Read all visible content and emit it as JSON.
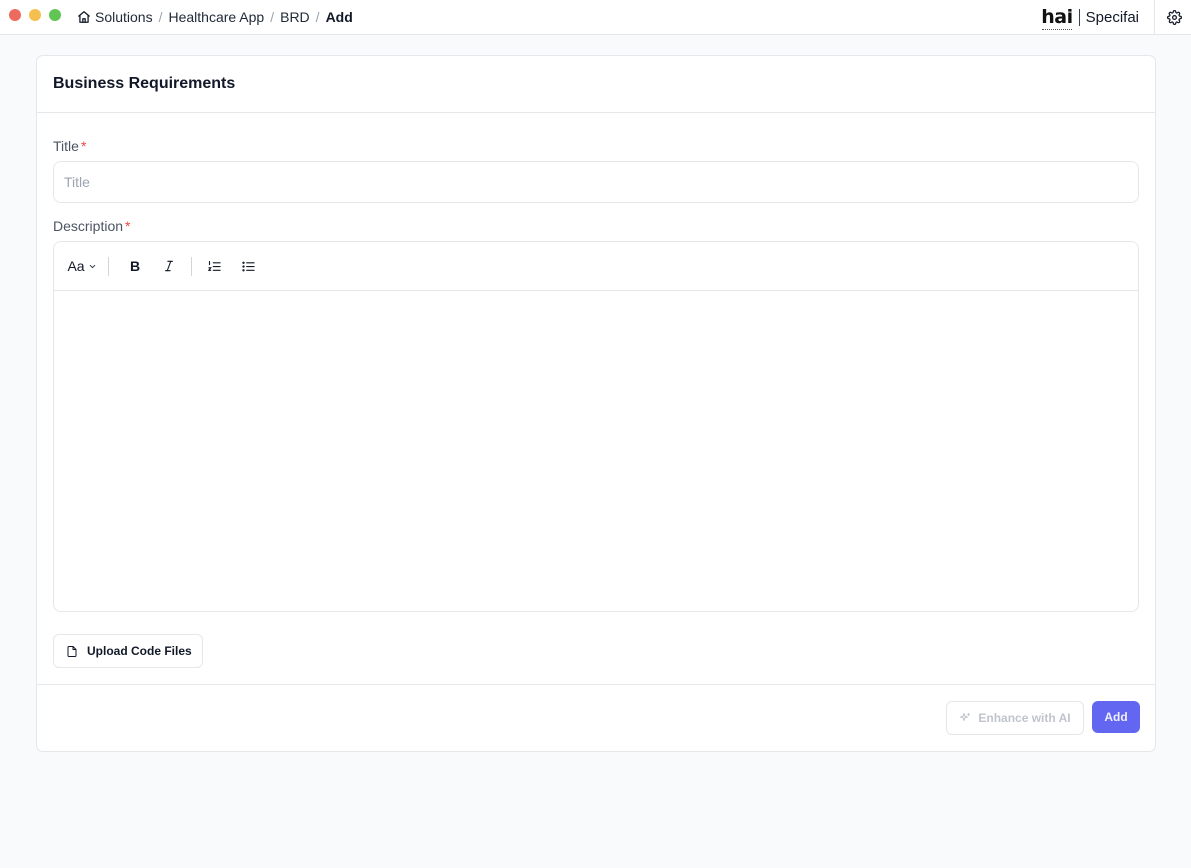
{
  "window": {
    "controls": [
      "close",
      "minimize",
      "maximize"
    ]
  },
  "breadcrumb": {
    "items": [
      "Solutions",
      "Healthcare App",
      "BRD"
    ],
    "current": "Add",
    "separator": "/"
  },
  "brand": {
    "logo_text": "hai",
    "product_name": "Specifai"
  },
  "card": {
    "title": "Business Requirements"
  },
  "form": {
    "title_label": "Title",
    "title_placeholder": "Title",
    "title_value": "",
    "description_label": "Description",
    "required_mark": "*",
    "description_value": ""
  },
  "editor_toolbar": {
    "font_size_label": "Aa",
    "bold_label": "B",
    "tools": [
      "font-size-dropdown",
      "bold",
      "italic",
      "ordered-list",
      "bullet-list"
    ]
  },
  "buttons": {
    "upload_label": "Upload Code Files",
    "enhance_label": "Enhance with AI",
    "add_label": "Add"
  },
  "colors": {
    "accent": "#6366f1",
    "required": "#ef4444",
    "border": "#e5e7eb",
    "background": "#f9fafb"
  },
  "icons": {
    "home": "home-icon",
    "settings": "gear-icon",
    "upload": "file-icon",
    "enhance": "sparkle-icon"
  }
}
